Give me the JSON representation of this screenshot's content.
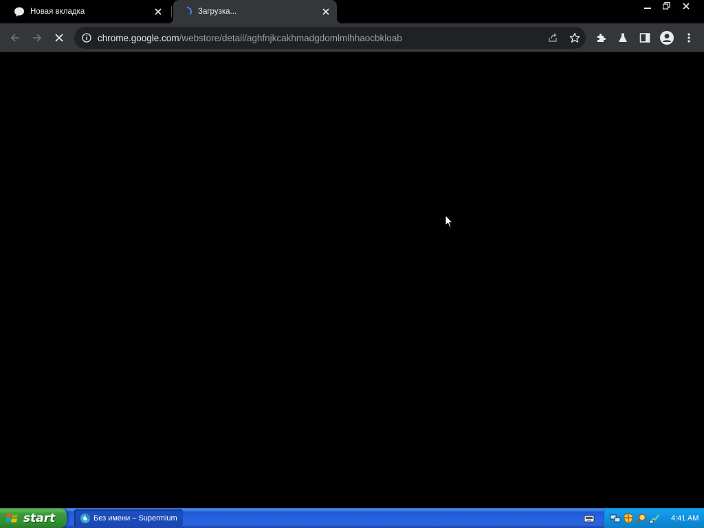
{
  "browser": {
    "tabs": [
      {
        "title": "Новая вкладка",
        "favicon": "chat-bubble-icon",
        "active": false
      },
      {
        "title": "Загрузка...",
        "favicon": "loading-spinner-icon",
        "active": true
      }
    ],
    "window_controls": [
      "minimize-icon",
      "restore-icon",
      "close-icon"
    ],
    "toolbar": {
      "back_icon": "arrow-left-icon",
      "forward_icon": "arrow-right-icon",
      "stop_icon": "stop-icon",
      "url_host": "chrome.google.com",
      "url_path": "/webstore/detail/aghfnjkcakhmadgdomlmlhhaocbkloab",
      "right_icons": [
        "share-icon",
        "star-icon",
        "puzzle-icon",
        "flask-icon",
        "side-panel-icon",
        "profile-icon",
        "kebab-menu-icon"
      ]
    }
  },
  "taskbar": {
    "start_label": "start",
    "items": [
      {
        "label": "Без имени – Supermium",
        "icon": "supermium-icon"
      }
    ],
    "clock": "4:41 AM"
  },
  "colors": {
    "tab_active_bg": "#35363a",
    "toolbar_bg": "#35363a",
    "omnibox_bg": "#202124",
    "content_bg": "#000000",
    "taskbar_blue": "#245edb",
    "start_green": "#3a9a3a",
    "tray_blue": "#1190e0"
  }
}
